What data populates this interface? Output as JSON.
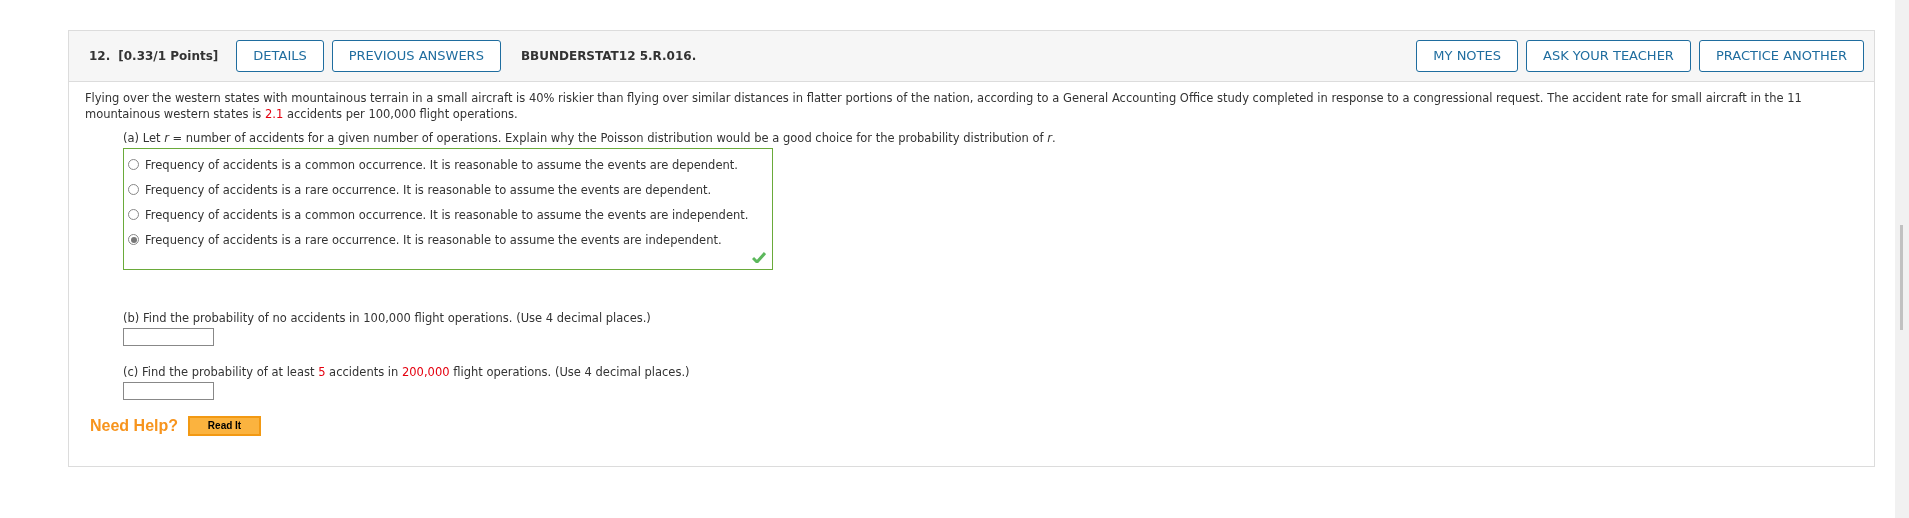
{
  "header": {
    "number": "12.",
    "points": "[0.33/1 Points]",
    "left_buttons": [
      "DETAILS",
      "PREVIOUS ANSWERS"
    ],
    "code": "BBUNDERSTAT12 5.R.016.",
    "right_buttons": [
      "MY NOTES",
      "ASK YOUR TEACHER",
      "PRACTICE ANOTHER"
    ]
  },
  "intro": [
    {
      "text": "Flying over the western states with mountainous terrain in a small aircraft is 40% riskier than flying over similar distances in flatter portions of the nation, according to a General Accounting Office study completed in response to a congressional request. The accident rate for small aircraft in the 11 mountainous western states is ",
      "highlight": false
    },
    {
      "text": "2.1",
      "highlight": true
    },
    {
      "text": " accidents per 100,000 flight operations.",
      "highlight": false
    }
  ],
  "part_a": {
    "prompt": "(a) Let *r* = number of accidents for a given number of operations. Explain why the Poisson distribution would be a good choice for the probability distribution of *r*.",
    "correct": true,
    "options": [
      {
        "label": "Frequency of accidents is a common occurrence. It is reasonable to assume the events are dependent.",
        "selected": false
      },
      {
        "label": "Frequency of accidents is a rare occurrence. It is reasonable to assume the events are dependent.",
        "selected": false
      },
      {
        "label": "Frequency of accidents is a common occurrence. It is reasonable to assume the events are independent.",
        "selected": false
      },
      {
        "label": "Frequency of accidents is a rare occurrence. It is reasonable to assume the events are independent.",
        "selected": true
      }
    ]
  },
  "part_b": {
    "prompt": [
      {
        "text": "(b) Find the probability of no accidents in 100,000 flight operations. (Use 4 decimal places.)",
        "highlight": false
      }
    ]
  },
  "part_c": {
    "prompt": [
      {
        "text": "(c) Find the probability of at least ",
        "highlight": false
      },
      {
        "text": "5",
        "highlight": true
      },
      {
        "text": " accidents in ",
        "highlight": false
      },
      {
        "text": "200,000",
        "highlight": true
      },
      {
        "text": " flight operations. (Use 4 decimal places.)",
        "highlight": false
      }
    ]
  },
  "help": {
    "label": "Need Help?",
    "button": "Read It"
  }
}
